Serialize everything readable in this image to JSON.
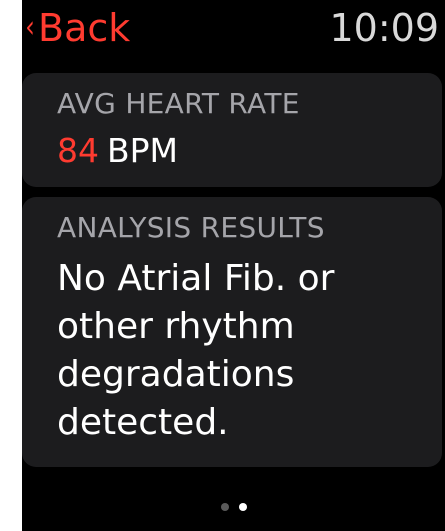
{
  "nav": {
    "back_label": "Back",
    "back_icon": "chevron-left-icon",
    "time": "10:09"
  },
  "heart_rate_card": {
    "title": "AVG HEART RATE",
    "value": "84",
    "unit": "BPM"
  },
  "analysis_card": {
    "title": "ANALYSIS RESULTS",
    "text": "No Atrial Fib. or other rhythm degradations detected."
  },
  "pager": {
    "page_count": 2,
    "current_page": 2
  },
  "colors": {
    "accent": "#ff3b30",
    "background": "#000000",
    "card": "#1c1c1e",
    "secondary_text": "#a5a5aa"
  }
}
